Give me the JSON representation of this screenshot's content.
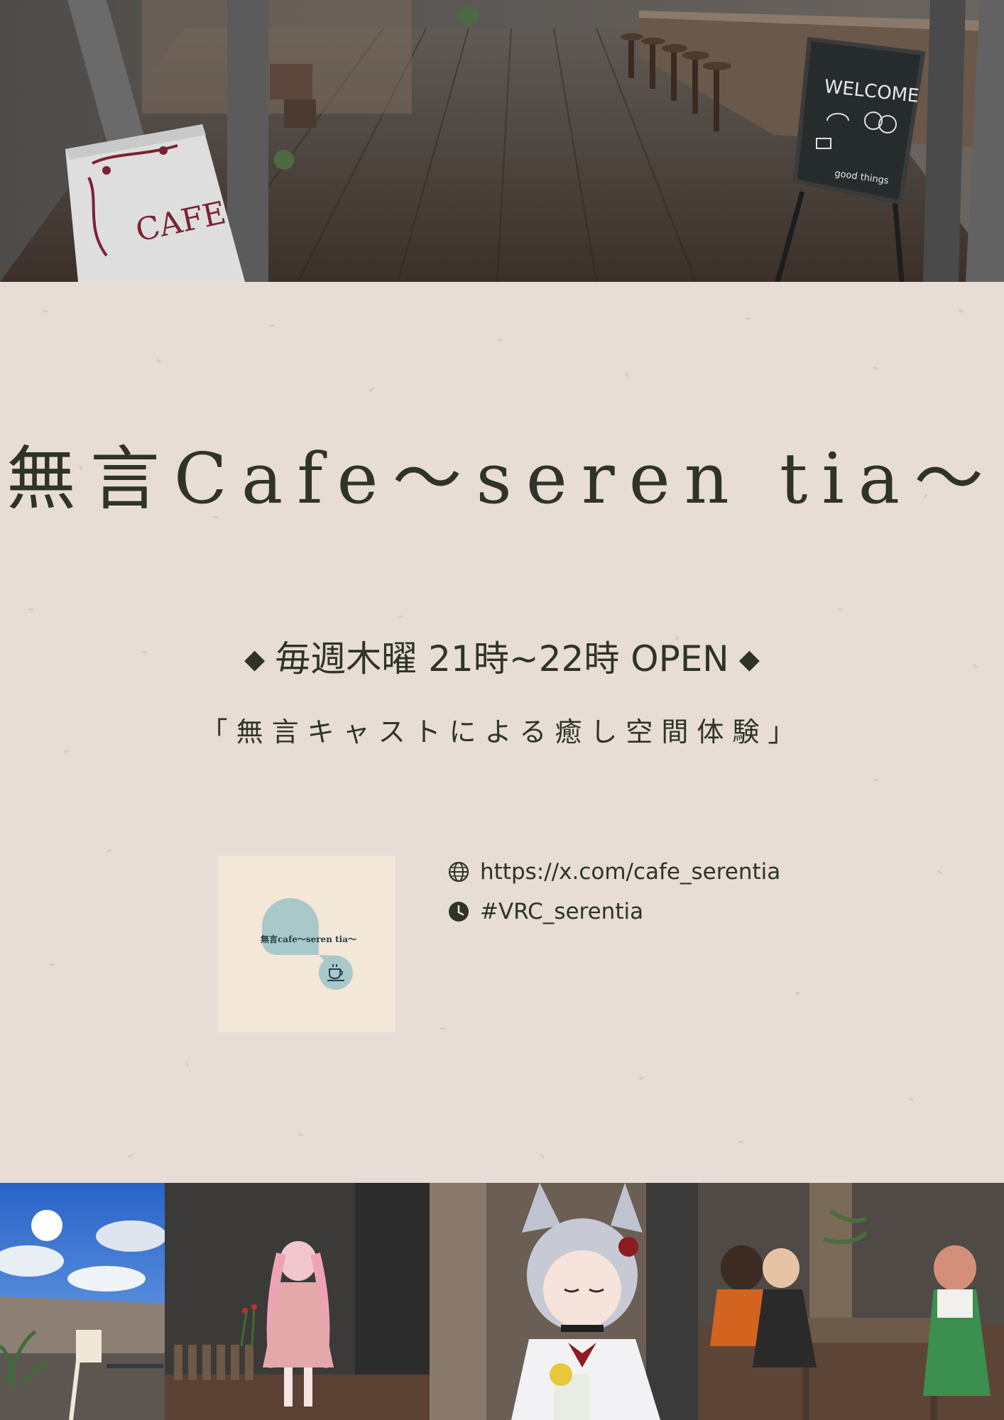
{
  "hero": {
    "cafe_sign_text": "CAFE",
    "chalkboard_title": "WELCOME",
    "chalkboard_footer": "good things"
  },
  "poster": {
    "title": "無言Cafe～seren tia～",
    "schedule": "毎週木曜 21時~22時 OPEN",
    "schedule_marker": "◆",
    "tagline": "「無言キャストによる癒し空間体験」"
  },
  "logo": {
    "text": "無言cafe～seren tia～",
    "icon": "coffee-cup-icon",
    "colors": {
      "background": "#f3e7d8",
      "accent": "#a9c8c9"
    }
  },
  "links": [
    {
      "icon": "globe-icon",
      "text": "https://x.com/cafe_serentia"
    },
    {
      "icon": "clock-icon",
      "text": "#VRC_serentia"
    }
  ],
  "colors": {
    "background": "#e7ddd6",
    "text": "#2f3328"
  }
}
